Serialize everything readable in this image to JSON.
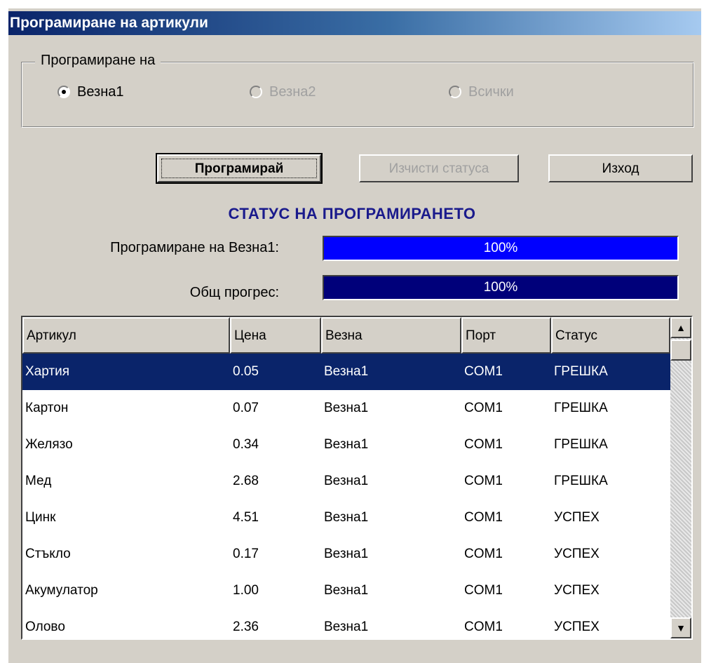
{
  "window": {
    "title": "Програмиране на артикули"
  },
  "group": {
    "title": "Програмиране на",
    "options": [
      {
        "label": "Везна1",
        "selected": true,
        "enabled": true
      },
      {
        "label": "Везна2",
        "selected": false,
        "enabled": false
      },
      {
        "label": "Всички",
        "selected": false,
        "enabled": false
      }
    ]
  },
  "buttons": {
    "program": "Програмирай",
    "clear_status": "Изчисти статуса",
    "exit": "Изход"
  },
  "status": {
    "heading": "СТАТУС НА ПРОГРАМИРАНЕТО",
    "scale_label": "Програмиране на Везна1:",
    "scale_progress": 100,
    "scale_progress_text": "100%",
    "total_label": "Общ прогрес:",
    "total_progress": 100,
    "total_progress_text": "100%",
    "scale_bar_color": "#0000ff",
    "total_bar_color": "#00007a"
  },
  "table": {
    "columns": [
      "Артикул",
      "Цена",
      "Везна",
      "Порт",
      "Статус"
    ],
    "rows": [
      [
        "Хартия",
        "0.05",
        "Везна1",
        "COM1",
        "ГРЕШКА"
      ],
      [
        "Картон",
        "0.07",
        "Везна1",
        "COM1",
        "ГРЕШКА"
      ],
      [
        "Желязо",
        "0.34",
        "Везна1",
        "COM1",
        "ГРЕШКА"
      ],
      [
        "Мед",
        "2.68",
        "Везна1",
        "COM1",
        "ГРЕШКА"
      ],
      [
        "Цинк",
        "4.51",
        "Везна1",
        "COM1",
        "УСПЕХ"
      ],
      [
        "Стъкло",
        "0.17",
        "Везна1",
        "COM1",
        "УСПЕХ"
      ],
      [
        "Акумулатор",
        "1.00",
        "Везна1",
        "COM1",
        "УСПЕХ"
      ],
      [
        "Олово",
        "2.36",
        "Везна1",
        "COM1",
        "УСПЕХ"
      ]
    ],
    "selected_row": 0
  },
  "icons": {
    "scroll_up": "arrow-up-icon",
    "scroll_down": "arrow-down-icon"
  }
}
